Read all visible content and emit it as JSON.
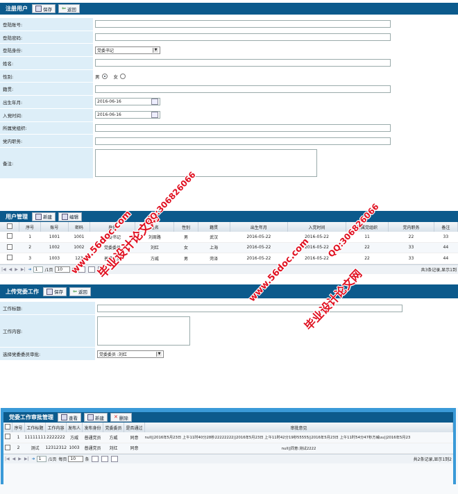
{
  "register": {
    "title": "注册用户",
    "save": "保存",
    "back": "返回",
    "fields": [
      {
        "label": "登陆账号:",
        "value": ""
      },
      {
        "label": "登陆密码:",
        "value": ""
      },
      {
        "label": "登陆身份:",
        "value": "党委书记"
      },
      {
        "label": "姓名:",
        "value": ""
      },
      {
        "label": "性别:",
        "value": ""
      },
      {
        "label": "籍贯:",
        "value": ""
      },
      {
        "label": "出生年月:",
        "value": "2016-06-16"
      },
      {
        "label": "入党时间:",
        "value": "2016-06-16"
      },
      {
        "label": "所属党组织:",
        "value": ""
      },
      {
        "label": "党内职务:",
        "value": ""
      },
      {
        "label": "备注:",
        "value": ""
      }
    ],
    "gender_male": "男",
    "gender_female": "女"
  },
  "users": {
    "title": "用户管理",
    "new": "新建",
    "edit": "编辑",
    "columns": [
      "序号",
      "账号",
      "密码",
      "身份",
      "姓名",
      "性别",
      "籍贯",
      "出生年月",
      "入党时间",
      "所属党组织",
      "党内职务",
      "备注"
    ],
    "rows": [
      [
        "1",
        "1001",
        "1001",
        "党委书记",
        "刘周路",
        "男",
        "武汉",
        "2016-05-22",
        "2016-05-22",
        "11",
        "22",
        "33"
      ],
      [
        "2",
        "1002",
        "1002",
        "党委委员",
        "刘红",
        "女",
        "上海",
        "2016-05-22",
        "2016-05-22",
        "22",
        "33",
        "44"
      ],
      [
        "3",
        "1003",
        "123",
        "普通党员",
        "方威",
        "男",
        "菏泽",
        "2016-05-22",
        "2016-05-22",
        "22",
        "33",
        "44"
      ]
    ],
    "pager": {
      "page": "1",
      "total": "/1页",
      "size": "10",
      "size_label": "条",
      "summary": "共3条记录,显示1到"
    }
  },
  "upload": {
    "title": "上传党委工作",
    "save": "保存",
    "back": "返回",
    "fields": [
      {
        "label": "工作标题:",
        "value": ""
      },
      {
        "label": "工作内容:",
        "value": ""
      },
      {
        "label": "选择党委委员审批:",
        "value": "党委委员 :刘红"
      }
    ]
  },
  "approval": {
    "title": "党委工作审批管理",
    "view": "查看",
    "new": "新建",
    "delete": "删除",
    "columns": [
      "序号",
      "工作标题",
      "工作内容",
      "发布人",
      "发布身份",
      "党委委员",
      "是否通过",
      "审批意见"
    ],
    "rows": [
      [
        "1",
        "11111111",
        "2222222",
        "方威",
        "普通党员",
        "方威",
        "同意",
        "null||2016年5月23日 上午11时40分28秒22222222||2016年5月23日 上午11时42分19秒55555||2016年5月23日 上午11时54分47秒方威uu||2016年5月23"
      ],
      [
        "2",
        "测试",
        "12312312",
        "1003",
        "普通党员",
        "刘红",
        "同意",
        "null||同意:测试2222"
      ]
    ],
    "pager": {
      "per_page_label": "每页",
      "size": "10",
      "size_label": "条",
      "page": "1",
      "total": "/1页",
      "summary": "共2条记录,显示1到2"
    }
  },
  "watermarks": {
    "site1": "www.56doc.com",
    "qq1": "QQ:306826066",
    "brand1": "毕业设计论文网",
    "site2": "www.56doc.com",
    "qq2": "QQ:306826066",
    "brand2": "毕业设计论文网"
  }
}
